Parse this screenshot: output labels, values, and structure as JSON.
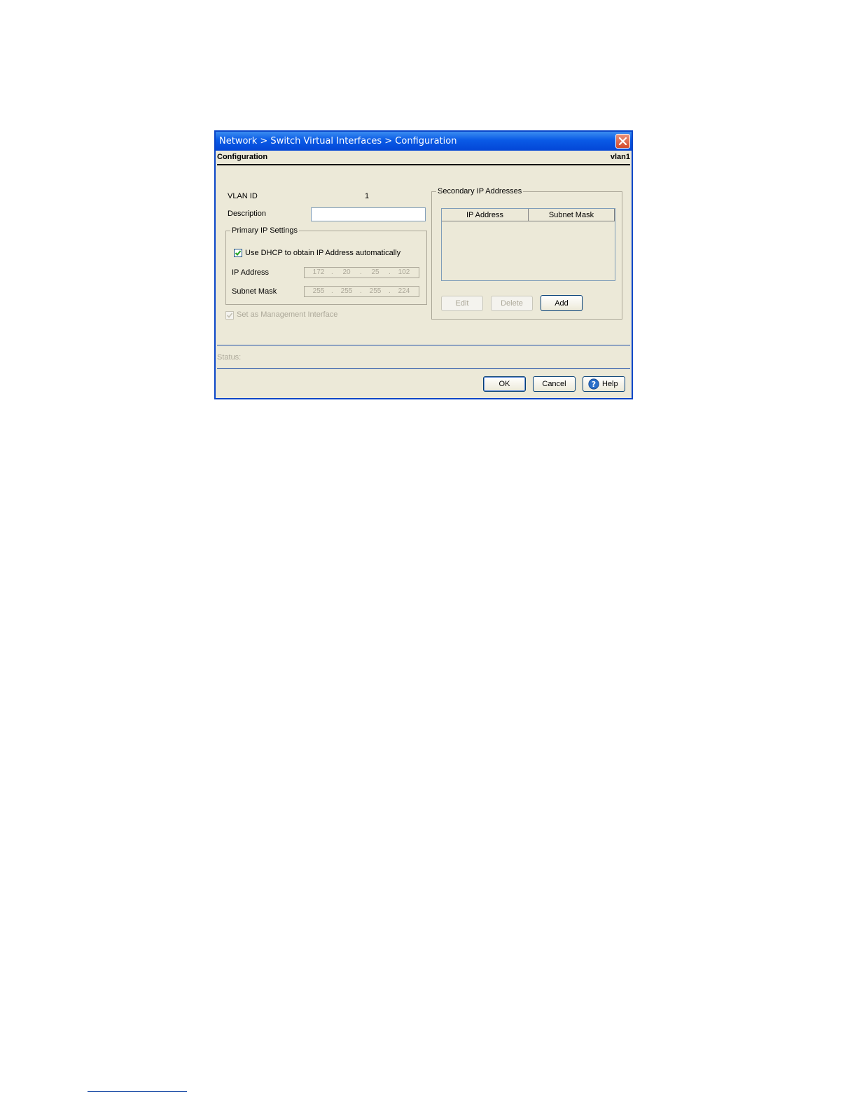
{
  "window": {
    "title": "Network > Switch Virtual Interfaces > Configuration"
  },
  "header": {
    "section": "Configuration",
    "interface": "vlan1"
  },
  "form": {
    "vlan_id_label": "VLAN ID",
    "vlan_id_value": "1",
    "description_label": "Description",
    "description_value": "",
    "primary": {
      "legend": "Primary IP Settings",
      "dhcp_label": "Use DHCP to obtain IP Address automatically",
      "dhcp_checked": true,
      "ip_label": "IP Address",
      "ip_octets": [
        "172",
        "20",
        "25",
        "102"
      ],
      "mask_label": "Subnet Mask",
      "mask_octets": [
        "255",
        "255",
        "255",
        "224"
      ]
    },
    "management_label": "Set as Management Interface",
    "management_checked": true
  },
  "secondary": {
    "legend": "Secondary IP Addresses",
    "columns": [
      "IP Address",
      "Subnet Mask"
    ],
    "rows": [],
    "edit_label": "Edit",
    "delete_label": "Delete",
    "add_label": "Add"
  },
  "status": {
    "label": "Status:"
  },
  "footer": {
    "ok_label": "OK",
    "cancel_label": "Cancel",
    "help_label": "Help"
  },
  "colors": {
    "titlebar": "#0a5ae6",
    "dialog_bg": "#ece9d8",
    "disabled_text": "#aca899"
  }
}
